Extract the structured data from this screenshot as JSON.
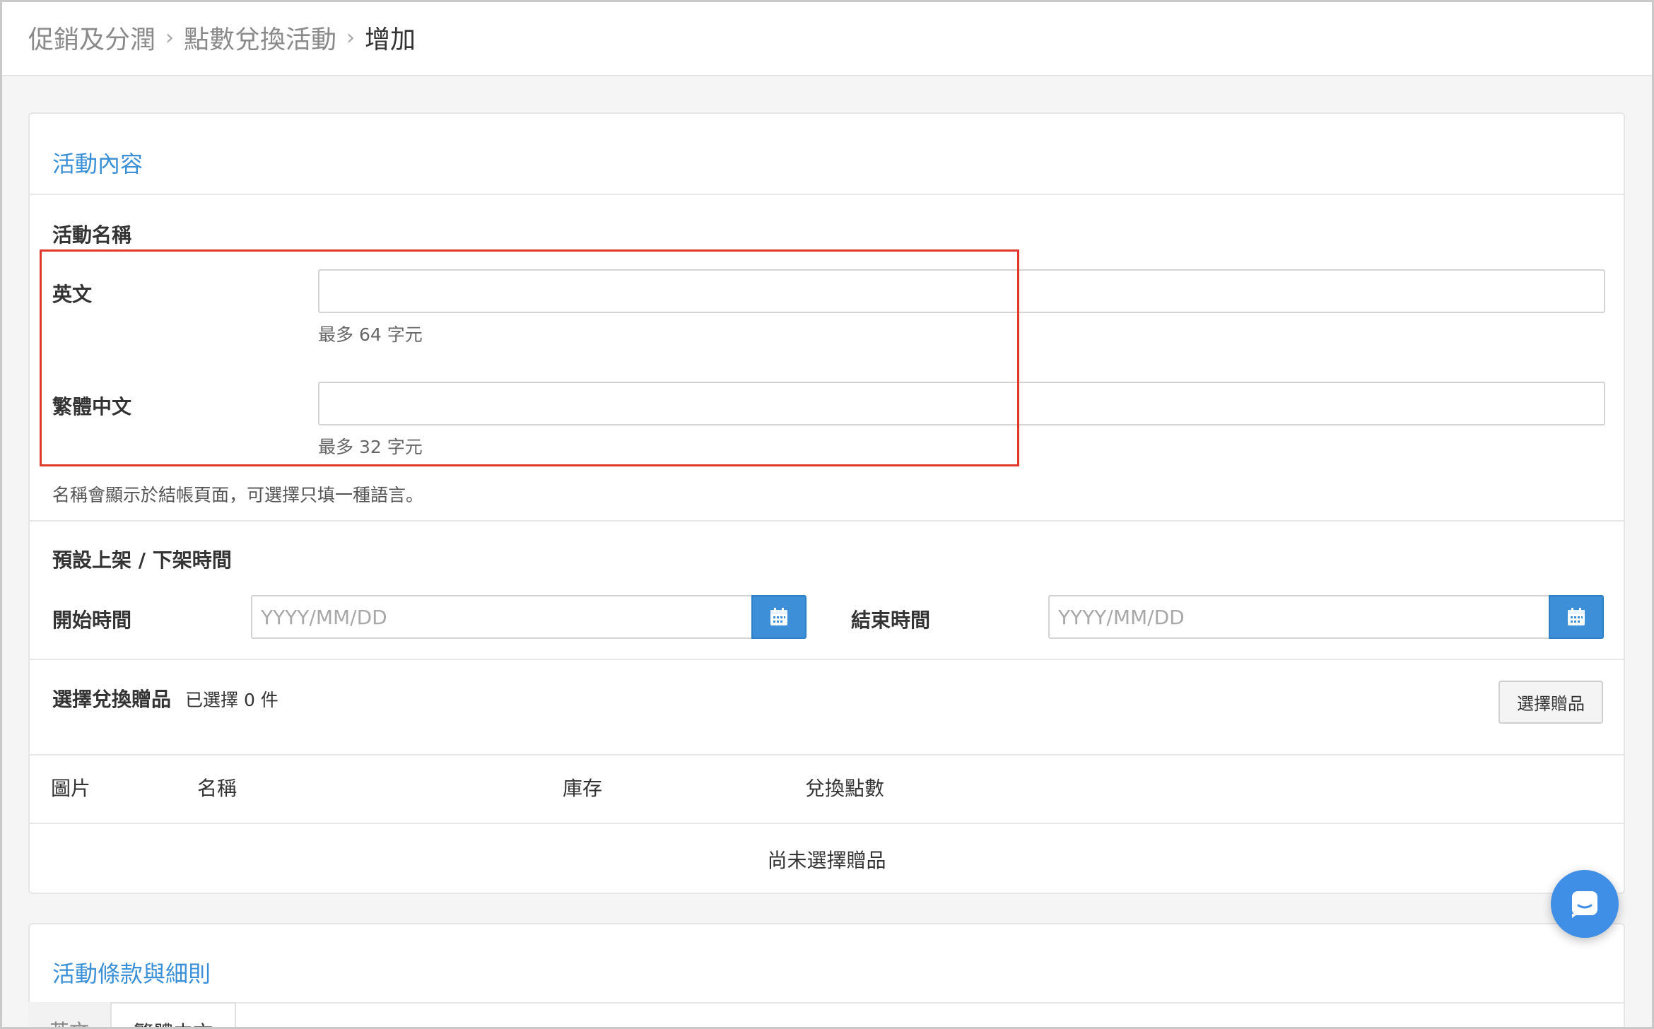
{
  "breadcrumb": {
    "items": [
      "促銷及分潤",
      "點數兌換活動",
      "增加"
    ]
  },
  "section_activity": {
    "title": "活動內容",
    "name_group_label": "活動名稱",
    "english_label": "英文",
    "english_value": "",
    "english_hint": "最多 64 字元",
    "chinese_label": "繁體中文",
    "chinese_value": "",
    "chinese_hint": "最多 32 字元",
    "name_note": "名稱會顯示於結帳頁面，可選擇只填一種語言。"
  },
  "schedule": {
    "title": "預設上架 / 下架時間",
    "start_label": "開始時間",
    "start_placeholder": "YYYY/MM/DD",
    "end_label": "結束時間",
    "end_placeholder": "YYYY/MM/DD",
    "calendar_icon": "calendar-icon"
  },
  "gifts": {
    "title": "選擇兌換贈品",
    "selected_count_text": "已選擇 0 件",
    "select_button": "選擇贈品",
    "columns": [
      "圖片",
      "名稱",
      "庫存",
      "兌換點數"
    ],
    "empty_message": "尚未選擇贈品"
  },
  "section_terms": {
    "title": "活動條款與細則",
    "tabs": [
      "英文",
      "繁體中文"
    ]
  },
  "colors": {
    "accent": "#3a8fd6",
    "highlight_box": "#e0392b",
    "chat_button": "#3f8fe6"
  },
  "chat_icon": "chat-icon"
}
